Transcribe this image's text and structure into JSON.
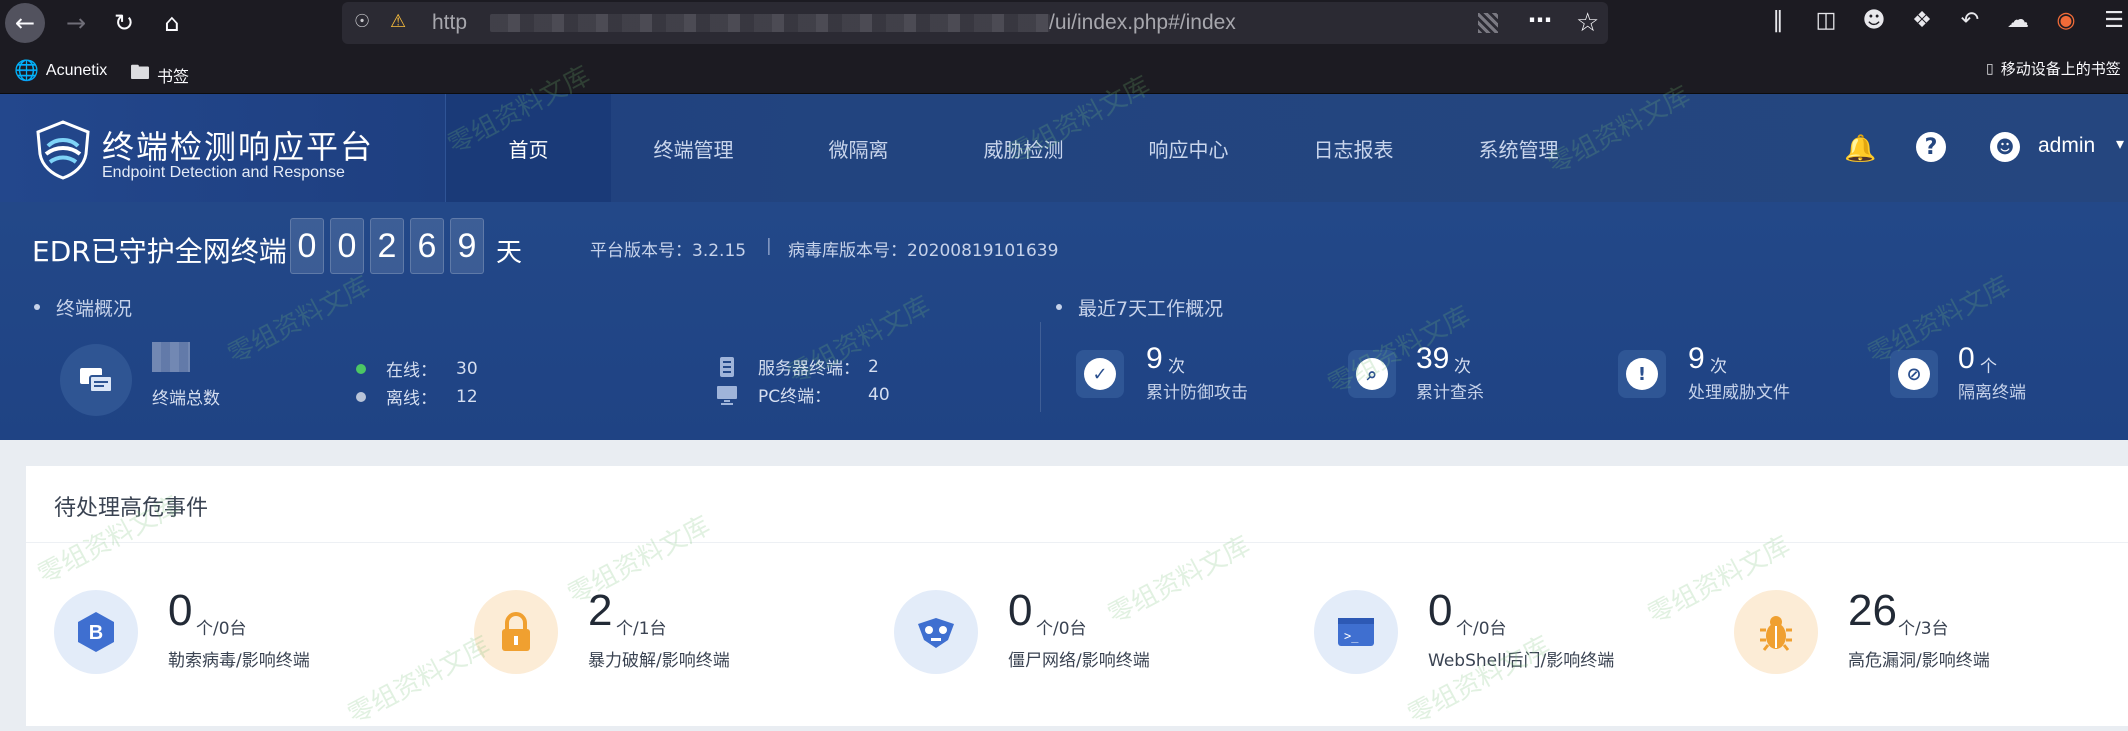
{
  "browser": {
    "url_prefix": "http",
    "url_path": "/ui/index.php#/index",
    "bookmarks": [
      {
        "label": "Acunetix",
        "icon": "globe-icon"
      },
      {
        "label": "书签",
        "icon": "folder-icon"
      }
    ],
    "mobile_bookmarks": "移动设备上的书签"
  },
  "app": {
    "title": "终端检测响应平台",
    "subtitle": "Endpoint Detection and Response",
    "nav": [
      "首页",
      "终端管理",
      "微隔离",
      "威胁检测",
      "响应中心",
      "日志报表",
      "系统管理"
    ],
    "active_nav": "首页",
    "username": "admin",
    "accent": "#23478c",
    "secondary_accent": "#f5a623"
  },
  "summary": {
    "edr_title": "EDR已守护全网终端",
    "days_digits": [
      "0",
      "0",
      "2",
      "6",
      "9"
    ],
    "days_unit": "天",
    "platform_version": "平台版本号：3.2.15",
    "virus_db_version": "病毒库版本号：20200819101639",
    "separator": "|",
    "overview_label": "终端概况",
    "total_label": "终端总数",
    "online_label": "在线：",
    "online_value": "30",
    "offline_label": "离线：",
    "offline_value": "12",
    "server_label": "服务器终端：",
    "server_value": "2",
    "pc_label": "PC终端：",
    "pc_value": "40",
    "week_label": "最近7天工作概况",
    "stats": [
      {
        "value": "9",
        "unit": "次",
        "label": "累计防御攻击",
        "icon": "shield-check-icon"
      },
      {
        "value": "39",
        "unit": "次",
        "label": "累计查杀",
        "icon": "scan-icon"
      },
      {
        "value": "9",
        "unit": "次",
        "label": "处理威胁文件",
        "icon": "file-alert-icon"
      },
      {
        "value": "0",
        "unit": "个",
        "label": "隔离终端",
        "icon": "isolate-icon"
      }
    ]
  },
  "events": {
    "title": "待处理高危事件",
    "items": [
      {
        "value": "0",
        "unit": "个/0台",
        "label": "勒索病毒/影响终端",
        "icon": "ransomware-icon",
        "tone": "blue"
      },
      {
        "value": "2",
        "unit": "个/1台",
        "label": "暴力破解/影响终端",
        "icon": "lock-icon",
        "tone": "orange"
      },
      {
        "value": "0",
        "unit": "个/0台",
        "label": "僵尸网络/影响终端",
        "icon": "botnet-icon",
        "tone": "blue"
      },
      {
        "value": "0",
        "unit": "个/0台",
        "label": "WebShell后门/影响终端",
        "icon": "terminal-icon",
        "tone": "blue"
      },
      {
        "value": "26",
        "unit": "个/3台",
        "label": "高危漏洞/影响终端",
        "icon": "bug-icon",
        "tone": "orange"
      }
    ]
  },
  "watermark": "零组资料文库"
}
